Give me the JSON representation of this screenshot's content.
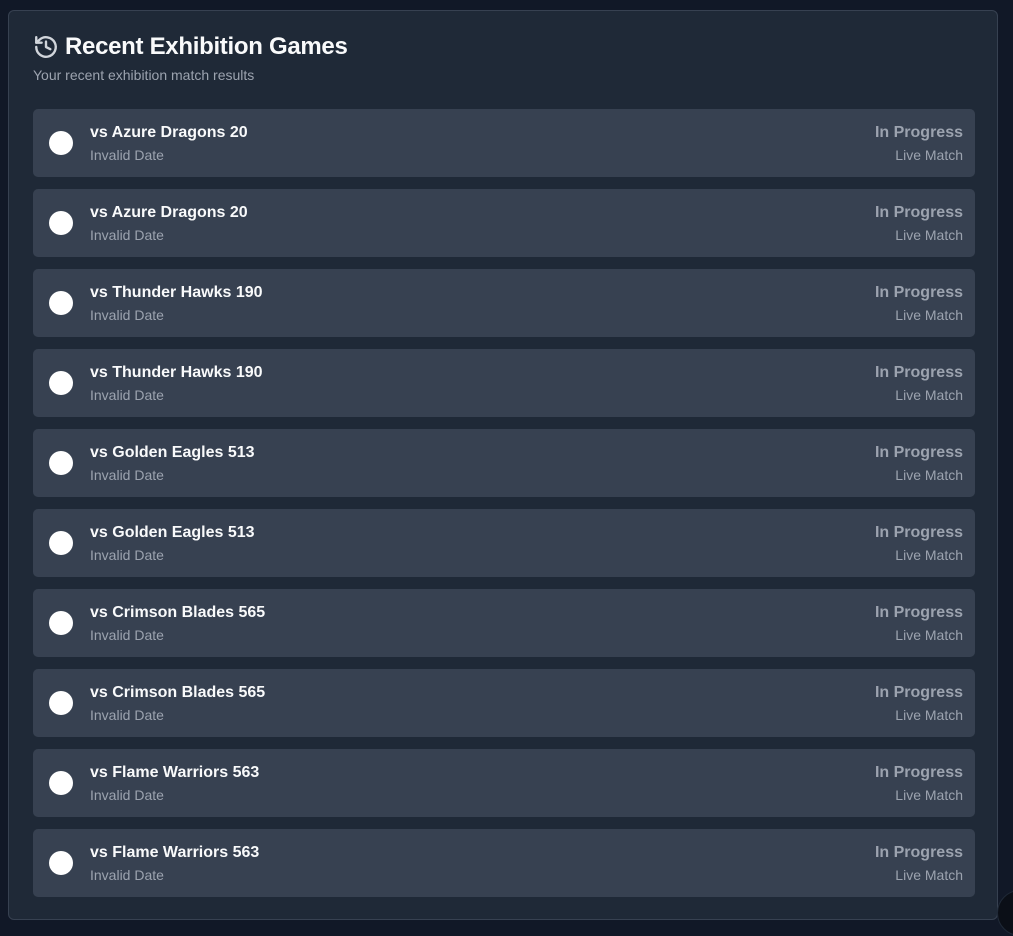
{
  "header": {
    "title": "Recent Exhibition Games",
    "subtitle": "Your recent exhibition match results",
    "icon": "history-icon"
  },
  "games": [
    {
      "opponent": "vs Azure Dragons 20",
      "date": "Invalid Date",
      "status": "In Progress",
      "kind": "Live Match"
    },
    {
      "opponent": "vs Azure Dragons 20",
      "date": "Invalid Date",
      "status": "In Progress",
      "kind": "Live Match"
    },
    {
      "opponent": "vs Thunder Hawks 190",
      "date": "Invalid Date",
      "status": "In Progress",
      "kind": "Live Match"
    },
    {
      "opponent": "vs Thunder Hawks 190",
      "date": "Invalid Date",
      "status": "In Progress",
      "kind": "Live Match"
    },
    {
      "opponent": "vs Golden Eagles 513",
      "date": "Invalid Date",
      "status": "In Progress",
      "kind": "Live Match"
    },
    {
      "opponent": "vs Golden Eagles 513",
      "date": "Invalid Date",
      "status": "In Progress",
      "kind": "Live Match"
    },
    {
      "opponent": "vs Crimson Blades 565",
      "date": "Invalid Date",
      "status": "In Progress",
      "kind": "Live Match"
    },
    {
      "opponent": "vs Crimson Blades 565",
      "date": "Invalid Date",
      "status": "In Progress",
      "kind": "Live Match"
    },
    {
      "opponent": "vs Flame Warriors 563",
      "date": "Invalid Date",
      "status": "In Progress",
      "kind": "Live Match"
    },
    {
      "opponent": "vs Flame Warriors 563",
      "date": "Invalid Date",
      "status": "In Progress",
      "kind": "Live Match"
    }
  ],
  "colors": {
    "page_bg": "#111827",
    "card_bg": "#1f2937",
    "row_bg": "#374151",
    "text_primary": "#f9fafb",
    "text_muted": "#9ca3af",
    "result_dot": "#ffffff"
  }
}
